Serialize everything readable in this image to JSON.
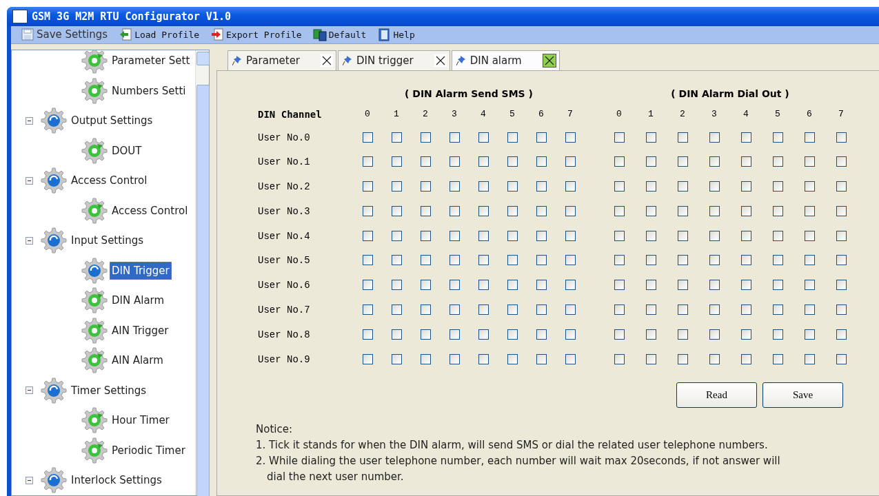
{
  "window": {
    "title": "GSM 3G M2M RTU Configurator V1.0"
  },
  "toolbar": [
    {
      "label": "Save Settings",
      "kind": "save"
    },
    {
      "label": "Load Profile",
      "kind": "load"
    },
    {
      "label": "Export Profile",
      "kind": "export"
    },
    {
      "label": "Default",
      "kind": "default"
    },
    {
      "label": "Help",
      "kind": "help"
    }
  ],
  "tree_continued": [
    {
      "label": "Parameter Sett",
      "selected": false
    },
    {
      "label": "Numbers Setti",
      "selected": false
    }
  ],
  "tree": [
    {
      "label": "Output Settings",
      "expanded": true,
      "children": [
        {
          "label": "DOUT",
          "selected": false
        }
      ]
    },
    {
      "label": "Access Control",
      "expanded": true,
      "children": [
        {
          "label": "Access Control",
          "selected": false
        }
      ]
    },
    {
      "label": "Input Settings",
      "expanded": true,
      "children": [
        {
          "label": "DIN Trigger",
          "selected": true
        },
        {
          "label": "DIN Alarm",
          "selected": false
        },
        {
          "label": "AIN Trigger",
          "selected": false
        },
        {
          "label": "AIN Alarm",
          "selected": false
        }
      ]
    },
    {
      "label": "Timer Settings",
      "expanded": true,
      "children": [
        {
          "label": "Hour Timer",
          "selected": false
        },
        {
          "label": "Periodic Timer",
          "selected": false
        }
      ]
    },
    {
      "label": "Interlock Settings",
      "expanded": true
    }
  ],
  "tabs": [
    {
      "label": "Parameter",
      "selected": false
    },
    {
      "label": "DIN trigger",
      "selected": false
    },
    {
      "label": "DIN alarm",
      "selected": true
    }
  ],
  "alarm_table": {
    "sms_title": "( DIN Alarm Send SMS )",
    "dial_title": "( DIN Alarm Dial Out )",
    "channel_header": "DIN Channel",
    "sms_channels": [
      "0",
      "1",
      "2",
      "3",
      "4",
      "5",
      "6",
      "7"
    ],
    "dial_channels": [
      "0",
      "1",
      "2",
      "3",
      "4",
      "5",
      "6",
      "7"
    ],
    "rows": [
      {
        "label": "User No.0",
        "sms": [
          false,
          false,
          false,
          false,
          false,
          false,
          false,
          false
        ],
        "dial": [
          false,
          false,
          false,
          false,
          false,
          false,
          false,
          false
        ]
      },
      {
        "label": "User No.1",
        "sms": [
          false,
          false,
          false,
          false,
          false,
          false,
          false,
          false
        ],
        "dial": [
          false,
          false,
          false,
          false,
          false,
          false,
          false,
          false
        ]
      },
      {
        "label": "User No.2",
        "sms": [
          false,
          false,
          false,
          false,
          false,
          false,
          false,
          false
        ],
        "dial": [
          false,
          false,
          false,
          false,
          false,
          false,
          false,
          false
        ]
      },
      {
        "label": "User No.3",
        "sms": [
          false,
          false,
          false,
          false,
          false,
          false,
          false,
          false
        ],
        "dial": [
          false,
          false,
          false,
          false,
          false,
          false,
          false,
          false
        ]
      },
      {
        "label": "User No.4",
        "sms": [
          false,
          false,
          false,
          false,
          false,
          false,
          false,
          false
        ],
        "dial": [
          false,
          false,
          false,
          false,
          false,
          false,
          false,
          false
        ]
      },
      {
        "label": "User No.5",
        "sms": [
          false,
          false,
          false,
          false,
          false,
          false,
          false,
          false
        ],
        "dial": [
          false,
          false,
          false,
          false,
          false,
          false,
          false,
          false
        ]
      },
      {
        "label": "User No.6",
        "sms": [
          false,
          false,
          false,
          false,
          false,
          false,
          false,
          false
        ],
        "dial": [
          false,
          false,
          false,
          false,
          false,
          false,
          false,
          false
        ]
      },
      {
        "label": "User No.7",
        "sms": [
          false,
          false,
          false,
          false,
          false,
          false,
          false,
          false
        ],
        "dial": [
          false,
          false,
          false,
          false,
          false,
          false,
          false,
          false
        ]
      },
      {
        "label": "User No.8",
        "sms": [
          false,
          false,
          false,
          false,
          false,
          false,
          false,
          false
        ],
        "dial": [
          false,
          false,
          false,
          false,
          false,
          false,
          false,
          false
        ]
      },
      {
        "label": "User No.9",
        "sms": [
          false,
          false,
          false,
          false,
          false,
          false,
          false,
          false
        ],
        "dial": [
          false,
          false,
          false,
          false,
          false,
          false,
          false,
          false
        ]
      }
    ]
  },
  "buttons": [
    "Read",
    "Save"
  ],
  "notice": {
    "title": "Notice:",
    "lines": [
      "1. Tick it stands for when the DIN alarm, will send SMS or dial the related user telephone numbers.",
      "2. While dialing the user telephone number, each number will wait max 20seconds, if not answer will",
      "dial the next user number."
    ]
  }
}
